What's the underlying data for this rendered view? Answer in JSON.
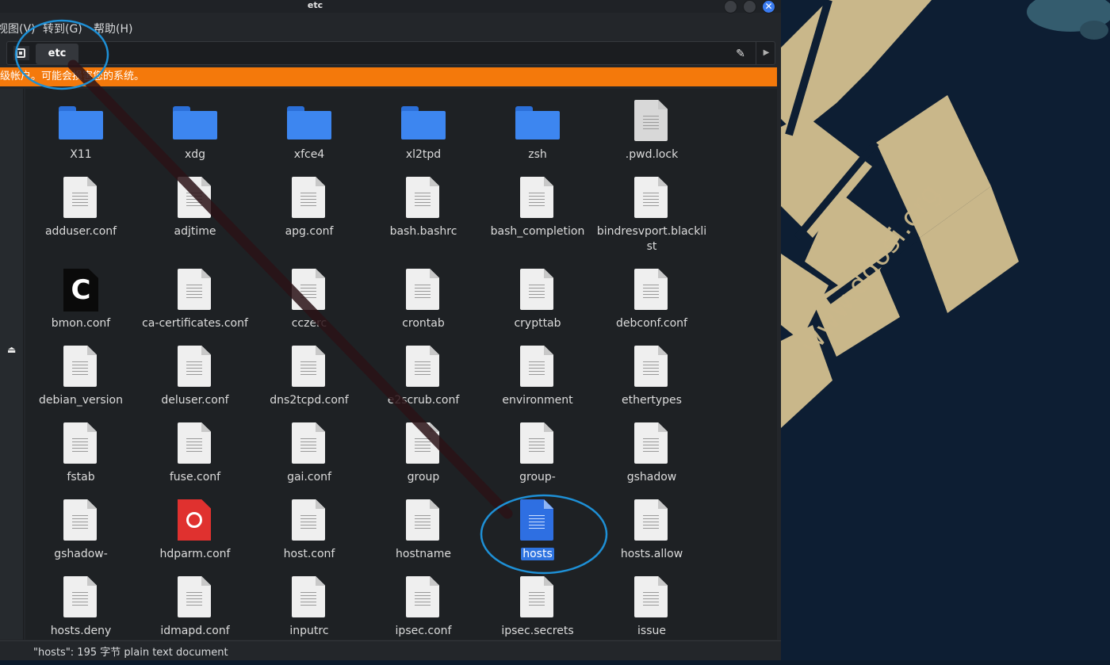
{
  "window": {
    "title": "etc",
    "close_glyph": "✕"
  },
  "menu": {
    "view": "视图(V)",
    "goto": "转到(G)",
    "help": "帮助(H)"
  },
  "pathbar": {
    "current_folder": "etc",
    "edit_glyph": "✎",
    "next_glyph": "▶"
  },
  "warning": {
    "text": "级帐户。可能会损害您的系统。"
  },
  "sidebar": {
    "eject_glyph": "⏏"
  },
  "files": [
    {
      "name": "X11",
      "type": "folder"
    },
    {
      "name": "xdg",
      "type": "folder"
    },
    {
      "name": "xfce4",
      "type": "folder"
    },
    {
      "name": "xl2tpd",
      "type": "folder"
    },
    {
      "name": "zsh",
      "type": "folder"
    },
    {
      "name": ".pwd.lock",
      "type": "file-grey"
    },
    {
      "name": "adduser.conf",
      "type": "text"
    },
    {
      "name": "adjtime",
      "type": "text"
    },
    {
      "name": "apg.conf",
      "type": "text"
    },
    {
      "name": "bash.bashrc",
      "type": "text"
    },
    {
      "name": "bash_completion",
      "type": "text"
    },
    {
      "name": "bindresvport.blacklist",
      "type": "text"
    },
    {
      "name": "bmon.conf",
      "type": "c-source"
    },
    {
      "name": "ca-certificates.conf",
      "type": "text"
    },
    {
      "name": "cczerc",
      "type": "text"
    },
    {
      "name": "crontab",
      "type": "text"
    },
    {
      "name": "crypttab",
      "type": "text"
    },
    {
      "name": "debconf.conf",
      "type": "text"
    },
    {
      "name": "debian_version",
      "type": "text"
    },
    {
      "name": "deluser.conf",
      "type": "text"
    },
    {
      "name": "dns2tcpd.conf",
      "type": "text"
    },
    {
      "name": "e2scrub.conf",
      "type": "text"
    },
    {
      "name": "environment",
      "type": "text"
    },
    {
      "name": "ethertypes",
      "type": "text"
    },
    {
      "name": "fstab",
      "type": "text"
    },
    {
      "name": "fuse.conf",
      "type": "text"
    },
    {
      "name": "gai.conf",
      "type": "text"
    },
    {
      "name": "group",
      "type": "text"
    },
    {
      "name": "group-",
      "type": "text"
    },
    {
      "name": "gshadow",
      "type": "text"
    },
    {
      "name": "gshadow-",
      "type": "text"
    },
    {
      "name": "hdparm.conf",
      "type": "hdparm"
    },
    {
      "name": "host.conf",
      "type": "text"
    },
    {
      "name": "hostname",
      "type": "text"
    },
    {
      "name": "hosts",
      "type": "text-selected"
    },
    {
      "name": "hosts.allow",
      "type": "text"
    },
    {
      "name": "hosts.deny",
      "type": "text"
    },
    {
      "name": "idmapd.conf",
      "type": "text"
    },
    {
      "name": "inputrc",
      "type": "text"
    },
    {
      "name": "ipsec.conf",
      "type": "text"
    },
    {
      "name": "ipsec.secrets",
      "type": "text"
    },
    {
      "name": "issue",
      "type": "text"
    }
  ],
  "status": {
    "text": "\"hosts\": 195 字节 plain text document"
  },
  "desktop": {
    "watermark": "www.ddosi.org"
  },
  "colors": {
    "warning_bg": "#f4790b",
    "selection": "#2f74e0",
    "folder": "#3d86f0",
    "annotation_circle": "#1e90d6",
    "wallpaper_gold": "#cbb88a"
  }
}
